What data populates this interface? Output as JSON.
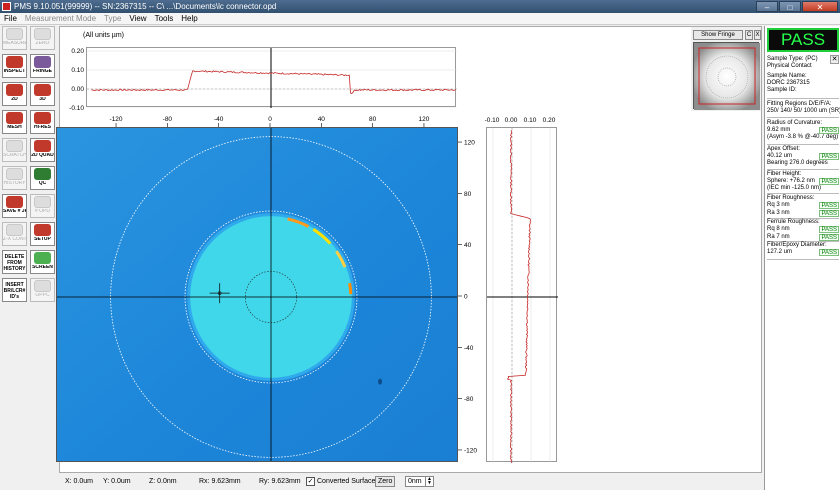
{
  "window": {
    "title": "PMS 9.10.051(99999) -- SN:2367315 -- C\\ ...\\Documents\\lc connector.opd",
    "minimize": "–",
    "maximize": "□",
    "close": "✕"
  },
  "menu": [
    "File",
    "Measurement Mode",
    "Type",
    "View",
    "Tools",
    "Help"
  ],
  "toolbar": [
    {
      "label": "MEASURE / RED",
      "enabled": false,
      "icon": "measure-icon"
    },
    {
      "label": "ZERO",
      "enabled": false,
      "icon": "zero-icon"
    },
    {
      "label": "INSPECT",
      "enabled": true,
      "icon": "inspect-icon"
    },
    {
      "label": "FRINGE",
      "enabled": true,
      "icon": "fringe-icon"
    },
    {
      "label": "2D",
      "enabled": true,
      "icon": "2d-icon"
    },
    {
      "label": "3D",
      "enabled": true,
      "icon": "3d-icon"
    },
    {
      "label": "MESH",
      "enabled": true,
      "icon": "mesh-icon"
    },
    {
      "label": "HI-RES",
      "enabled": true,
      "icon": "hires-icon"
    },
    {
      "label": "SCRATCH ANALYSIS",
      "enabled": false,
      "icon": "scratch-icon"
    },
    {
      "label": "2D QUAD",
      "enabled": true,
      "icon": "quad-icon"
    },
    {
      "label": "HISTORY",
      "enabled": false,
      "icon": "history-icon"
    },
    {
      "label": "QC",
      "enabled": true,
      "icon": "qc-icon"
    },
    {
      "label": "SAVE # JPG",
      "enabled": true,
      "icon": "save-icon"
    },
    {
      "label": "# OPD",
      "enabled": false,
      "icon": "opd-icon"
    },
    {
      "label": "Z-X CONTROL",
      "enabled": false,
      "icon": "zx-control-icon"
    },
    {
      "label": "SETUP",
      "enabled": true,
      "icon": "setup-icon"
    },
    {
      "label": "DELETE FROM HISTORY",
      "enabled": true,
      "icon": "delete-icon"
    },
    {
      "label": "SCREEN",
      "enabled": true,
      "icon": "screen-icon"
    },
    {
      "label": "INSERT BR/LCR# ID's",
      "enabled": true,
      "icon": "insert-icon"
    },
    {
      "label": "OPPC",
      "enabled": false,
      "icon": "oppc-icon"
    }
  ],
  "units_note": "(All units µm)",
  "profile_top": {
    "y_ticks": [
      "0.20",
      "0.10",
      "0.00",
      "-0.10"
    ],
    "y_values": [
      0.2,
      0.1,
      0.0,
      -0.1
    ],
    "step_edges": [
      -63,
      62
    ],
    "plateau": 0.095
  },
  "map": {
    "x_ticks": [
      "-120",
      "-80",
      "-40",
      "0",
      "40",
      "80",
      "120"
    ],
    "x_values": [
      -120,
      -80,
      -40,
      0,
      40,
      80,
      120
    ],
    "y_ticks": [
      "120",
      "80",
      "40",
      "0",
      "-40",
      "-80",
      "-120"
    ],
    "y_values": [
      120,
      80,
      40,
      0,
      -40,
      -80,
      -120
    ],
    "fiber_radius": 63,
    "inner_ring_radius": 20,
    "mid_ring_radius": 67,
    "outer_ring_radius": 125,
    "colors": {
      "background": "#1d86d9",
      "ferrule": "#3fd7e9",
      "highlight": "#ffe100"
    }
  },
  "profile_side": {
    "x_ticks": [
      "-0.10",
      "0.00",
      "0.10",
      "0.20"
    ],
    "x_values": [
      -0.1,
      0.0,
      0.1,
      0.2
    ],
    "step_edges": [
      63,
      -62
    ],
    "plateau": 0.095
  },
  "preview": {
    "show_fringe_button": "Show Fringe",
    "c_button": "C",
    "x_button": "X"
  },
  "panel": {
    "status": "PASS",
    "sample_type": "Sample Type: (PC)",
    "contact": "Physical Contact",
    "sample_name_label": "Sample Name:",
    "sample_name": "DORC 2367315",
    "sample_id_label": "Sample ID:",
    "fitting_label": "Fitting Regions D/E/F/A:",
    "fitting_value": "250/ 140/ 50/ 1000 um   (SR)",
    "roc_label": "Radius of Curvature:",
    "roc_value": "9.62 mm",
    "roc_asym": "(Asym -3.8 % @-40.7 deg)",
    "apex_label": "Apex Offset:",
    "apex_value": "40.12 um",
    "apex_bearing": "Bearing 276.0 degrees",
    "height_label": "Fiber Height:",
    "height_value": "Sphere: +76.2 nm",
    "height_iec": "(IEC min -125.0 nm)",
    "fiber_rough_label": "Fiber Roughness:",
    "fiber_rq": "Rq         3 nm",
    "fiber_ra": "Ra         3 nm",
    "ferrule_rough_label": "Ferrule Roughness:",
    "ferrule_rq": "Rq         8 nm",
    "ferrule_ra": "Ra         7 nm",
    "diameter_label": "Fiber/Epoxy Diameter:",
    "diameter_value": "127.2 um",
    "pass": "PASS"
  },
  "status": {
    "x": "X:   0.0um",
    "y": "Y:   0.0um",
    "z": "Z:   0.0nm",
    "rx": "Rx:   9.623mm",
    "ry": "Ry:   9.623mm",
    "converted_surface": "Converted Surface",
    "zero_button": "Zero",
    "nm_value": "0nm"
  }
}
